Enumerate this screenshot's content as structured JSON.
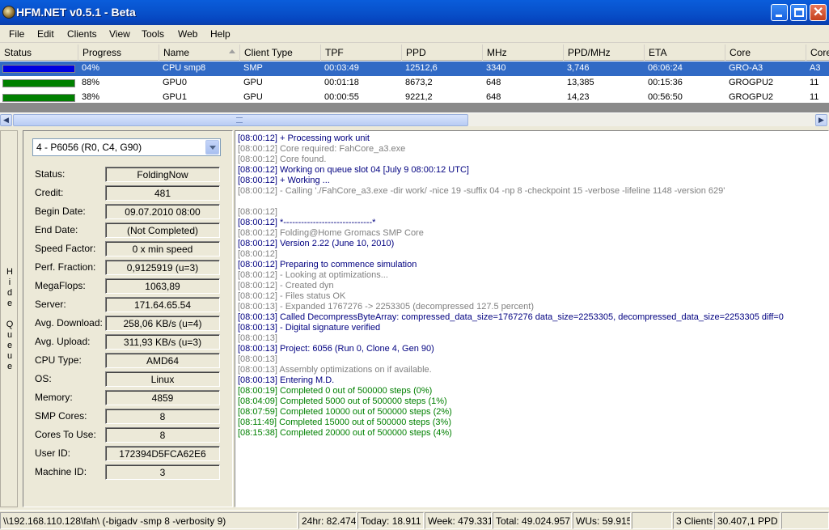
{
  "window": {
    "title": "HFM.NET v0.5.1 - Beta"
  },
  "menu": [
    "File",
    "Edit",
    "Clients",
    "View",
    "Tools",
    "Web",
    "Help"
  ],
  "grid": {
    "columns": [
      "Status",
      "Progress",
      "Name",
      "Client Type",
      "TPF",
      "PPD",
      "MHz",
      "PPD/MHz",
      "ETA",
      "Core",
      "Core"
    ],
    "rows": [
      {
        "status_color": "#0000e0",
        "progress": "04%",
        "name": "CPU smp8",
        "client_type": "SMP",
        "tpf": "00:03:49",
        "ppd": "12512,6",
        "mhz": "3340",
        "ppd_mhz": "3,746",
        "eta": "06:06:24",
        "core": "GRO-A3",
        "core_id": "A3",
        "selected": true
      },
      {
        "status_color": "#008000",
        "progress": "88%",
        "name": "GPU0",
        "client_type": "GPU",
        "tpf": "00:01:18",
        "ppd": "8673,2",
        "mhz": "648",
        "ppd_mhz": "13,385",
        "eta": "00:15:36",
        "core": "GROGPU2",
        "core_id": "11",
        "selected": false
      },
      {
        "status_color": "#008000",
        "progress": "38%",
        "name": "GPU1",
        "client_type": "GPU",
        "tpf": "00:00:55",
        "ppd": "9221,2",
        "mhz": "648",
        "ppd_mhz": "14,23",
        "eta": "00:56:50",
        "core": "GROGPU2",
        "core_id": "11",
        "selected": false
      }
    ]
  },
  "sidebar": {
    "hide_queue": [
      "H",
      "i",
      "d",
      "e",
      "",
      "Q",
      "u",
      "e",
      "u",
      "e"
    ]
  },
  "queue": {
    "selected_wu": "4 - P6056 (R0, C4, G90)",
    "fields": [
      {
        "label": "Status:",
        "value": "FoldingNow"
      },
      {
        "label": "Credit:",
        "value": "481"
      },
      {
        "label": "Begin Date:",
        "value": "09.07.2010 08:00"
      },
      {
        "label": "End Date:",
        "value": "(Not Completed)"
      },
      {
        "label": "Speed Factor:",
        "value": "0 x min speed"
      },
      {
        "label": "Perf. Fraction:",
        "value": "0,9125919 (u=3)"
      },
      {
        "label": "MegaFlops:",
        "value": "1063,89"
      },
      {
        "label": "Server:",
        "value": "171.64.65.54"
      },
      {
        "label": "Avg. Download:",
        "value": "258,06 KB/s (u=4)"
      },
      {
        "label": "Avg. Upload:",
        "value": "311,93 KB/s (u=3)"
      },
      {
        "label": "CPU Type:",
        "value": "AMD64"
      },
      {
        "label": "OS:",
        "value": "Linux"
      },
      {
        "label": "Memory:",
        "value": "4859"
      },
      {
        "label": "SMP Cores:",
        "value": "8"
      },
      {
        "label": "Cores To Use:",
        "value": "8"
      },
      {
        "label": "User ID:",
        "value": "172394D5FCA62E6"
      },
      {
        "label": "Machine ID:",
        "value": "3"
      }
    ]
  },
  "log": [
    {
      "text": "[08:00:12] + Processing work unit",
      "color": "#000080"
    },
    {
      "text": "[08:00:12] Core required: FahCore_a3.exe",
      "color": "#808080"
    },
    {
      "text": "[08:00:12] Core found.",
      "color": "#808080"
    },
    {
      "text": "[08:00:12] Working on queue slot 04 [July 9 08:00:12 UTC]",
      "color": "#000080"
    },
    {
      "text": "[08:00:12] + Working ...",
      "color": "#000080"
    },
    {
      "text": "[08:00:12] - Calling './FahCore_a3.exe -dir work/ -nice 19 -suffix 04 -np 8 -checkpoint 15 -verbose -lifeline 1148 -version 629'",
      "color": "#808080"
    },
    {
      "text": "",
      "color": "#808080"
    },
    {
      "text": "[08:00:12]",
      "color": "#808080"
    },
    {
      "text": "[08:00:12] *------------------------------*",
      "color": "#000080"
    },
    {
      "text": "[08:00:12] Folding@Home Gromacs SMP Core",
      "color": "#808080"
    },
    {
      "text": "[08:00:12] Version 2.22 (June 10, 2010)",
      "color": "#000080"
    },
    {
      "text": "[08:00:12]",
      "color": "#808080"
    },
    {
      "text": "[08:00:12] Preparing to commence simulation",
      "color": "#000080"
    },
    {
      "text": "[08:00:12] - Looking at optimizations...",
      "color": "#808080"
    },
    {
      "text": "[08:00:12] - Created dyn",
      "color": "#808080"
    },
    {
      "text": "[08:00:12] - Files status OK",
      "color": "#808080"
    },
    {
      "text": "[08:00:13] - Expanded 1767276 -> 2253305 (decompressed 127.5 percent)",
      "color": "#808080"
    },
    {
      "text": "[08:00:13] Called DecompressByteArray: compressed_data_size=1767276 data_size=2253305, decompressed_data_size=2253305 diff=0",
      "color": "#000080"
    },
    {
      "text": "[08:00:13] - Digital signature verified",
      "color": "#000080"
    },
    {
      "text": "[08:00:13]",
      "color": "#808080"
    },
    {
      "text": "[08:00:13] Project: 6056 (Run 0, Clone 4, Gen 90)",
      "color": "#000080"
    },
    {
      "text": "[08:00:13]",
      "color": "#808080"
    },
    {
      "text": "[08:00:13] Assembly optimizations on if available.",
      "color": "#808080"
    },
    {
      "text": "[08:00:13] Entering M.D.",
      "color": "#000080"
    },
    {
      "text": "[08:00:19] Completed 0 out of 500000 steps  (0%)",
      "color": "#008000"
    },
    {
      "text": "[08:04:09] Completed 5000 out of 500000 steps  (1%)",
      "color": "#008000"
    },
    {
      "text": "[08:07:59] Completed 10000 out of 500000 steps  (2%)",
      "color": "#008000"
    },
    {
      "text": "[08:11:49] Completed 15000 out of 500000 steps  (3%)",
      "color": "#008000"
    },
    {
      "text": "[08:15:38] Completed 20000 out of 500000 steps  (4%)",
      "color": "#008000"
    }
  ],
  "statusbar": {
    "path": "\\\\192.168.110.128\\fah\\ (-bigadv -smp 8 -verbosity 9)",
    "h24": "24hr: 82.474",
    "today": "Today: 18.911",
    "week": "Week: 479.331",
    "total": "Total: 49.024.957",
    "wus": "WUs: 59.915",
    "clients": "3 Clients",
    "ppd": "30.407,1 PPD"
  }
}
